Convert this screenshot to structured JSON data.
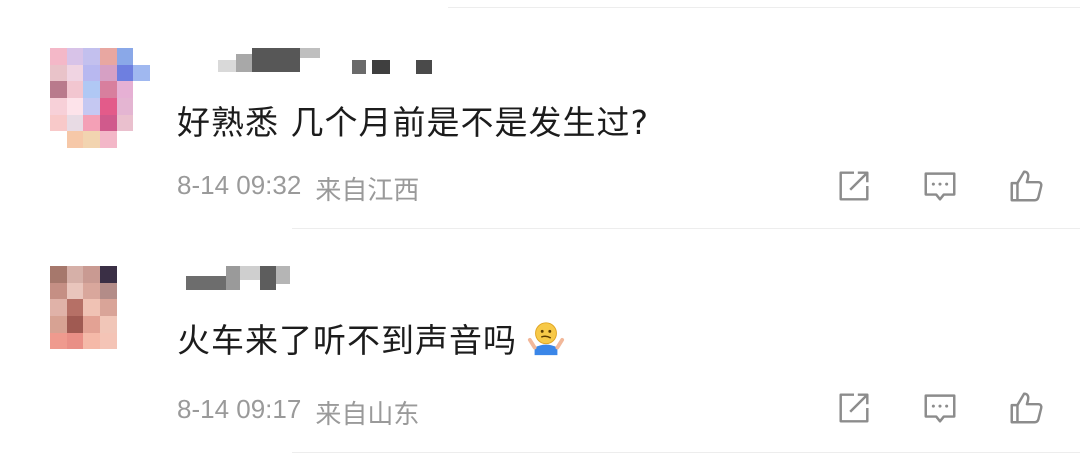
{
  "comments": [
    {
      "text": "好熟悉 几个月前是不是发生过?",
      "time": "8-14 09:32",
      "location": "来自江西",
      "emoji": "",
      "avatar_colors": [
        "#f4b8c8",
        "#d8c3e8",
        "#c3c0ee",
        "#e8a7a1",
        "#8aa8e8",
        "#ffffff",
        "#e9c3c9",
        "#f0d4e2",
        "#b8b8f0",
        "#d6a0c4",
        "#6e7fe0",
        "#a0b8f0",
        "#b97a8c",
        "#f2c6d0",
        "#b0c8f4",
        "#d87f9e",
        "#e6b0d4",
        "#ffffff",
        "#f7d0d8",
        "#fde3ea",
        "#c5c8f2",
        "#e35b8a",
        "#e4b5d2",
        "#ffffff",
        "#f8c9c9",
        "#e8dbe4",
        "#f4a0b6",
        "#d05a8c",
        "#eac0ce",
        "#ffffff",
        "#ffffff",
        "#f6c8a8",
        "#f2d4b0",
        "#f3b7c8",
        "#ffffff",
        "#ffffff"
      ],
      "icons": [
        "share-icon",
        "reply-icon",
        "like-icon"
      ]
    },
    {
      "text": "火车来了听不到声音吗",
      "time": "8-14 09:17",
      "location": "来自山东",
      "emoji": "shrug-emoji",
      "avatar_colors": [
        "#a6786c",
        "#d6b0a8",
        "#c99a92",
        "#3a2f45",
        "#ffffff",
        "#ffffff",
        "#c58f84",
        "#e9c5bc",
        "#d9a79c",
        "#b38c88",
        "#ffffff",
        "#ffffff",
        "#e0b2a8",
        "#b67066",
        "#f0c2b4",
        "#d9a498",
        "#ffffff",
        "#ffffff",
        "#d7a293",
        "#a05a52",
        "#e3a294",
        "#f1c6b8",
        "#ffffff",
        "#ffffff",
        "#ef9a8e",
        "#e98f86",
        "#f5b9a8",
        "#f4c4b6",
        "#ffffff",
        "#ffffff",
        "#ffffff",
        "#ffffff",
        "#ffffff",
        "#ffffff",
        "#ffffff",
        "#ffffff"
      ],
      "icons": [
        "share-icon",
        "reply-icon",
        "like-icon"
      ]
    }
  ],
  "colors": {
    "text": "#1c1c1c",
    "meta": "#9a9a9a",
    "icon": "#8c8c8c",
    "divider": "#ededed"
  }
}
